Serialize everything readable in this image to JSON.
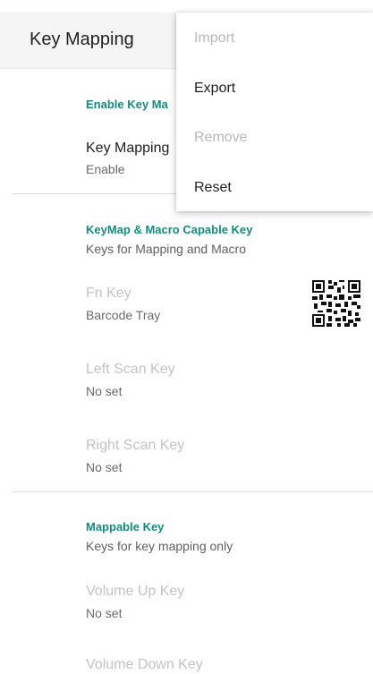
{
  "appbar": {
    "title": "Key Mapping"
  },
  "sections": {
    "enable": {
      "category": "Enable Key Ma",
      "items": [
        {
          "title": "Key Mapping",
          "summary": "Enable"
        }
      ]
    },
    "capable": {
      "category": "KeyMap & Macro Capable Key",
      "summary": "Keys for Mapping and Macro",
      "items": [
        {
          "title": "Fn Key",
          "summary": "Barcode Tray"
        },
        {
          "title": "Left Scan Key",
          "summary": "No set"
        },
        {
          "title": "Right Scan Key",
          "summary": "No set"
        }
      ]
    },
    "mappable": {
      "category": "Mappable Key",
      "summary": "Keys for key mapping only",
      "items": [
        {
          "title": "Volume Up Key",
          "summary": "No set"
        },
        {
          "title": "Volume Down Key"
        }
      ]
    }
  },
  "menu": {
    "items": [
      {
        "label": "Import",
        "enabled": false
      },
      {
        "label": "Export",
        "enabled": true
      },
      {
        "label": "Remove",
        "enabled": false
      },
      {
        "label": "Reset",
        "enabled": true
      }
    ]
  },
  "icons": {
    "qr": "qr-code-icon"
  },
  "colors": {
    "accent": "#138c80"
  }
}
